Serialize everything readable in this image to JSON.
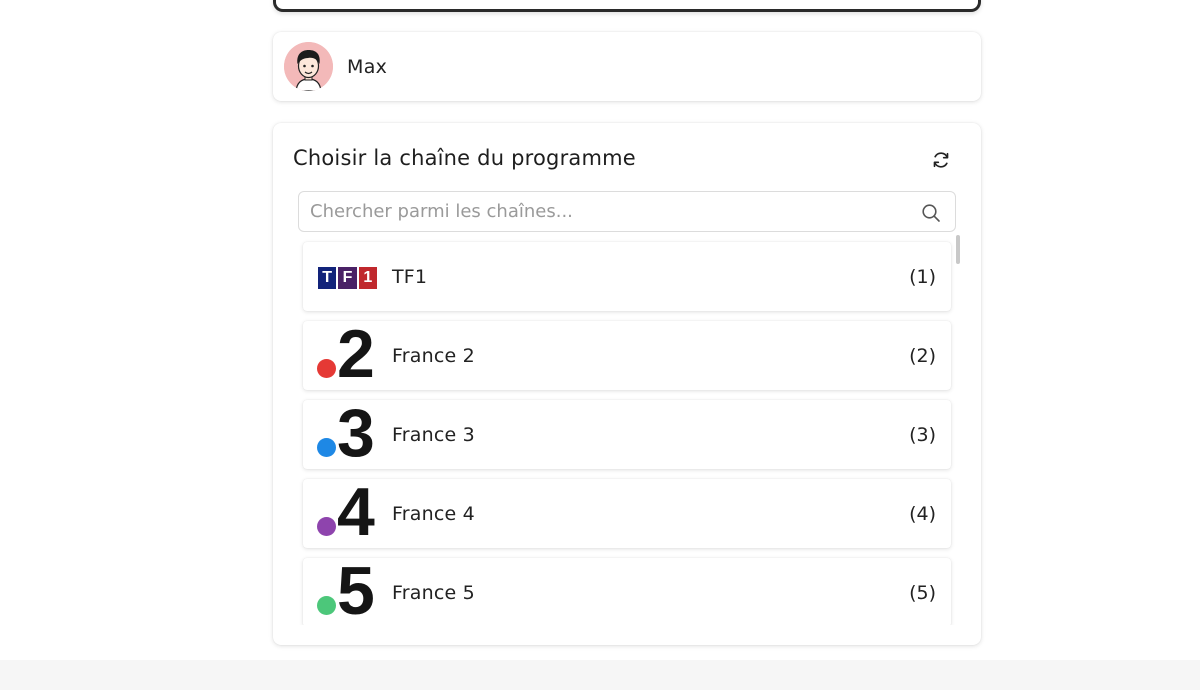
{
  "user": {
    "name": "Max"
  },
  "channel_picker": {
    "title": "Choisir la chaîne du programme",
    "search_placeholder": "Chercher parmi les chaînes...",
    "search_value": "",
    "channels": [
      {
        "name": "TF1",
        "number": "(1)",
        "logo": "tf1-logo",
        "logo_text": [
          "T",
          "F",
          "1"
        ]
      },
      {
        "name": "France 2",
        "number": "(2)",
        "logo": "france-2-logo",
        "logo_digit": "2",
        "dot_color": "#e53935"
      },
      {
        "name": "France 3",
        "number": "(3)",
        "logo": "france-3-logo",
        "logo_digit": "3",
        "dot_color": "#1e88e5"
      },
      {
        "name": "France 4",
        "number": "(4)",
        "logo": "france-4-logo",
        "logo_digit": "4",
        "dot_color": "#8e44ad"
      },
      {
        "name": "France 5",
        "number": "(5)",
        "logo": "france-5-logo",
        "logo_digit": "5",
        "dot_color": "#4cc77a"
      }
    ]
  },
  "icons": {
    "refresh": "refresh-icon",
    "search": "search-icon",
    "avatar": "avatar-illustration"
  },
  "colors": {
    "tf1_blue": "#12237a",
    "tf1_red": "#c0282d"
  }
}
